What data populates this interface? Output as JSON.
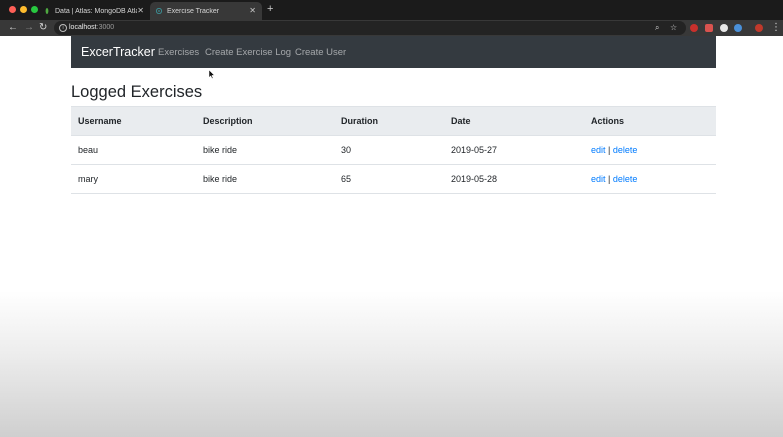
{
  "browser": {
    "tabs": [
      {
        "title": "Data | Atlas: MongoDB Atlas",
        "active": false
      },
      {
        "title": "Exercise Tracker",
        "active": true
      }
    ],
    "url_host": "localhost",
    "url_port": ":3000",
    "colors": {
      "mongodb_leaf": "#4faa41",
      "exercise_favicon": "#3c8a8f"
    }
  },
  "app": {
    "brand": "ExcerTracker",
    "nav": {
      "exercises": "Exercises",
      "create_log": "Create Exercise Log",
      "create_user": "Create User"
    },
    "page_title": "Logged Exercises",
    "table": {
      "headers": [
        "Username",
        "Description",
        "Duration",
        "Date",
        "Actions"
      ],
      "rows": [
        {
          "username": "beau",
          "description": "bike ride",
          "duration": "30",
          "date": "2019-05-27"
        },
        {
          "username": "mary",
          "description": "bike ride",
          "duration": "65",
          "date": "2019-05-28"
        }
      ],
      "edit_label": "edit",
      "separator": "|",
      "delete_label": "delete"
    }
  }
}
